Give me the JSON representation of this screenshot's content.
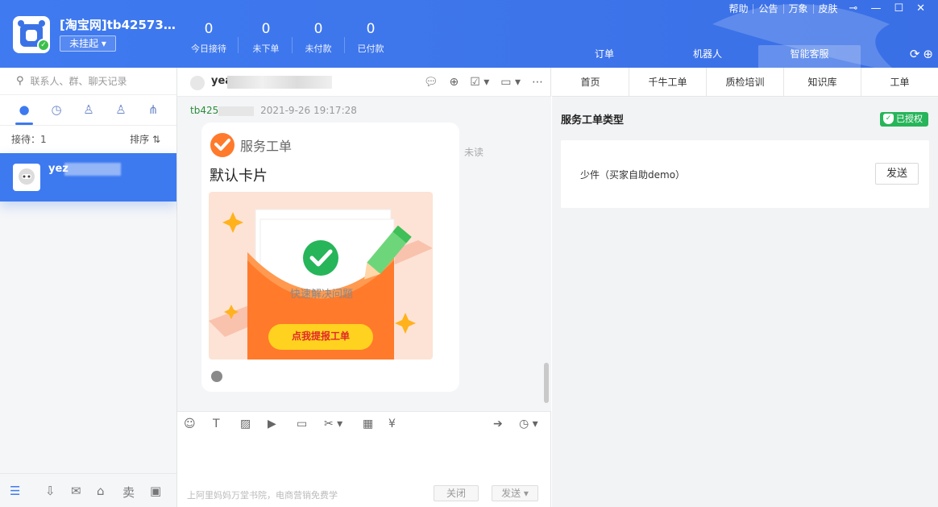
{
  "header": {
    "shop_name": "[淘宝网]tb425734...",
    "status_label": "未挂起",
    "stats": [
      {
        "value": "0",
        "label": "今日接待"
      },
      {
        "value": "0",
        "label": "未下单"
      },
      {
        "value": "0",
        "label": "未付款"
      },
      {
        "value": "0",
        "label": "已付款"
      }
    ],
    "top_links": [
      "帮助",
      "公告",
      "万象",
      "皮肤"
    ],
    "tabs": [
      "订单",
      "机器人",
      "智能客服"
    ],
    "active_tab": "智能客服"
  },
  "left": {
    "search_placeholder": "联系人、群、聊天记录",
    "queue_label": "接待：1",
    "sort_label": "排序 ⇅",
    "contact_name": "yez"
  },
  "middle": {
    "chat_name": "yea",
    "sender": "tb425",
    "timestamp": "2021-9-26 19:17:28",
    "card": {
      "header": "服务工单",
      "title": "默认卡片",
      "image_text": "快速解决问题",
      "image_button": "点我提报工单"
    },
    "unread": "未读",
    "promo": "上阿里妈妈万堂书院，电商营销免费学",
    "close_label": "关闭",
    "send_label": "发送 ▾"
  },
  "right": {
    "tabs": [
      "首页",
      "千牛工单",
      "质检培训",
      "知识库",
      "工单"
    ],
    "section_title": "服务工单类型",
    "auth_badge": "已授权",
    "item_label": "少件（买家自助demo）",
    "send_button": "发送"
  },
  "colors": {
    "brand_blue": "#3d7af0",
    "green": "#27b55a",
    "orange": "#ff7a2b"
  }
}
